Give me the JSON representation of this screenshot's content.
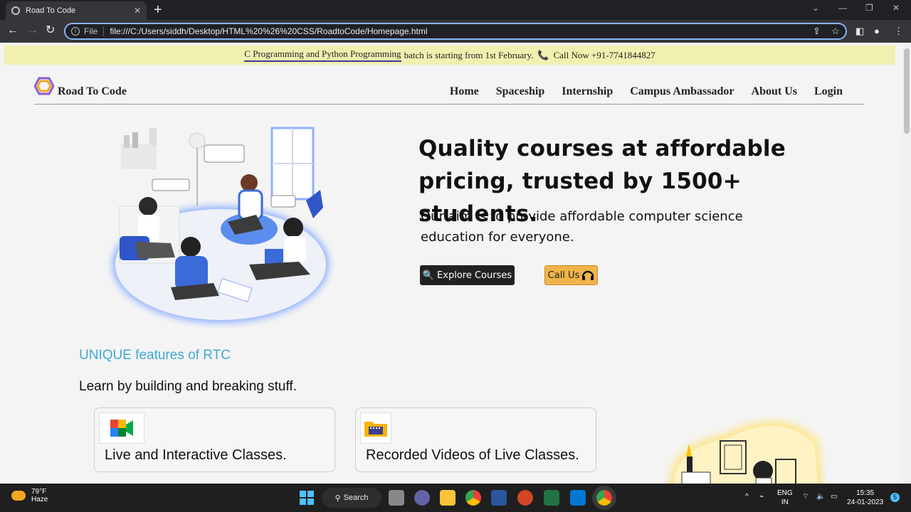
{
  "browser": {
    "tab_title": "Road To Code",
    "new_tab_label": "+",
    "url_scheme": "File",
    "url": "file:///C:/Users/siddh/Desktop/HTML%20%26%20CSS/RoadtoCode/Homepage.html",
    "window_controls": [
      "chevron-down-icon",
      "minimize-icon",
      "restore-icon",
      "close-icon"
    ]
  },
  "announcement": {
    "highlight": "C Programming and Python Programming",
    "text": "batch is starting from 1st February.",
    "phone_icon": "📞",
    "call_text": "Call Now +91-7741844827"
  },
  "header": {
    "brand": "Road To Code",
    "menu": [
      "Home",
      "Spaceship",
      "Internship",
      "Campus Ambassador",
      "About Us",
      "Login"
    ]
  },
  "hero": {
    "title": "Quality courses at affordable pricing, trusted by 1500+ students.",
    "subtitle": "Our aim is to provide affordable computer science education for everyone.",
    "explore_label": "Explore Courses",
    "call_label": "Call Us"
  },
  "features": {
    "title": "UNIQUE features of RTC",
    "subtitle": "Learn by building and breaking stuff.",
    "cards": [
      {
        "label": "Live and Interactive Classes.",
        "icon": "video-meet-icon"
      },
      {
        "label": "Recorded Videos of Live Classes.",
        "icon": "film-folder-icon"
      }
    ]
  },
  "taskbar": {
    "temperature": "79°F",
    "condition": "Haze",
    "search_label": "Search",
    "lang_top": "ENG",
    "lang_bottom": "IN",
    "time": "15:35",
    "date": "24-01-2023",
    "notification_count": "5"
  },
  "colors": {
    "announcement_bg": "#f0f0b0",
    "accent_blue": "#3fa9d6",
    "call_button": "#f0b44a"
  }
}
